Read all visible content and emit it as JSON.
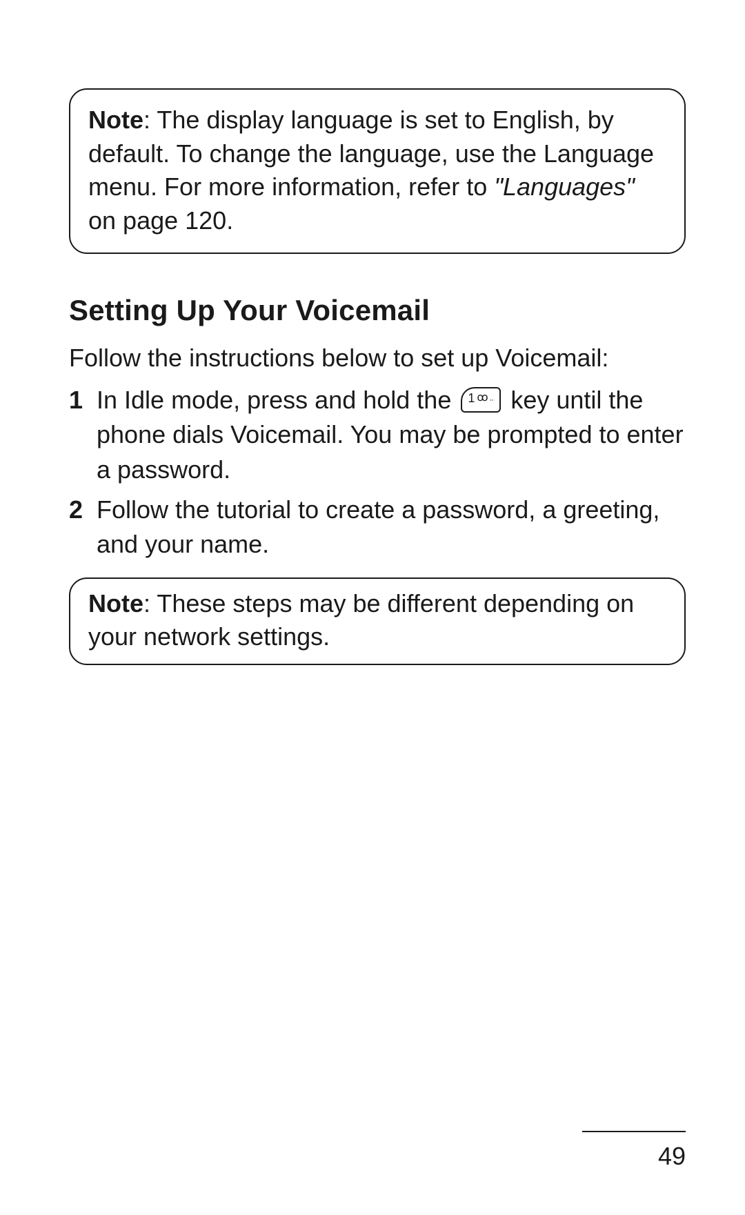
{
  "note1": {
    "label": "Note",
    "text_part1": ": The display language is set to English, by default. To change the language, use the Language menu. For more information, refer to ",
    "ref_italic": "\"Languages\"",
    "text_part2": " on page 120."
  },
  "section": {
    "heading": "Setting Up Your Voicemail",
    "intro": "Follow the instructions below to set up Voicemail:",
    "steps": [
      {
        "num": "1",
        "pre": "In Idle mode, press and hold the ",
        "key_label": "1",
        "post": " key until the phone dials Voicemail. You may be prompted to enter a password."
      },
      {
        "num": "2",
        "pre": "Follow the tutorial to create a password, a greeting, and your name.",
        "key_label": "",
        "post": ""
      }
    ]
  },
  "note2": {
    "label": "Note",
    "text": ": These steps may be different depending on your network settings."
  },
  "page_number": "49"
}
